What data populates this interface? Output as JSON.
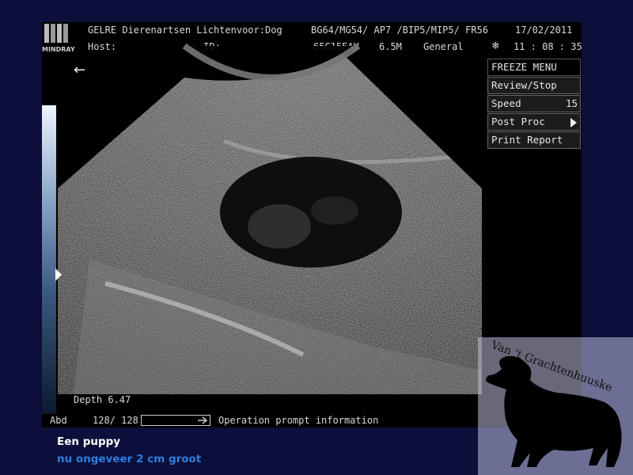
{
  "header": {
    "logo_text": "MINDRAY",
    "clinic": "GELRE Dierenartsen Lichtenvoor",
    "species": "Dog",
    "params": "BG64/MG54/ AP7 /BIP5/MIP5/ FR56",
    "date": "17/02/2011",
    "host_label": "Host:",
    "id_label": "ID:",
    "probe": "65C15EAV",
    "freq": "6.5M",
    "mode": "General",
    "time": "11 : 08 : 35"
  },
  "menu": {
    "title": "FREEZE MENU",
    "items": [
      {
        "label": "Review/Stop",
        "value": ""
      },
      {
        "label": "Speed",
        "value": "15"
      },
      {
        "label": "Post Proc",
        "value": ""
      },
      {
        "label": "Print Report",
        "value": ""
      }
    ]
  },
  "status": {
    "depth": "Depth  6.47",
    "preset": "Abd",
    "frames": "128/ 128",
    "prompt": "Operation prompt information"
  },
  "captions": {
    "line1": "Een puppy",
    "line2": "nu ongeveer 2 cm groot"
  },
  "watermark": {
    "text": "Van 't Grachtenhuuske"
  },
  "colors": {
    "page_bg": "#0b0f3a",
    "caption_accent": "#2e7de0"
  }
}
